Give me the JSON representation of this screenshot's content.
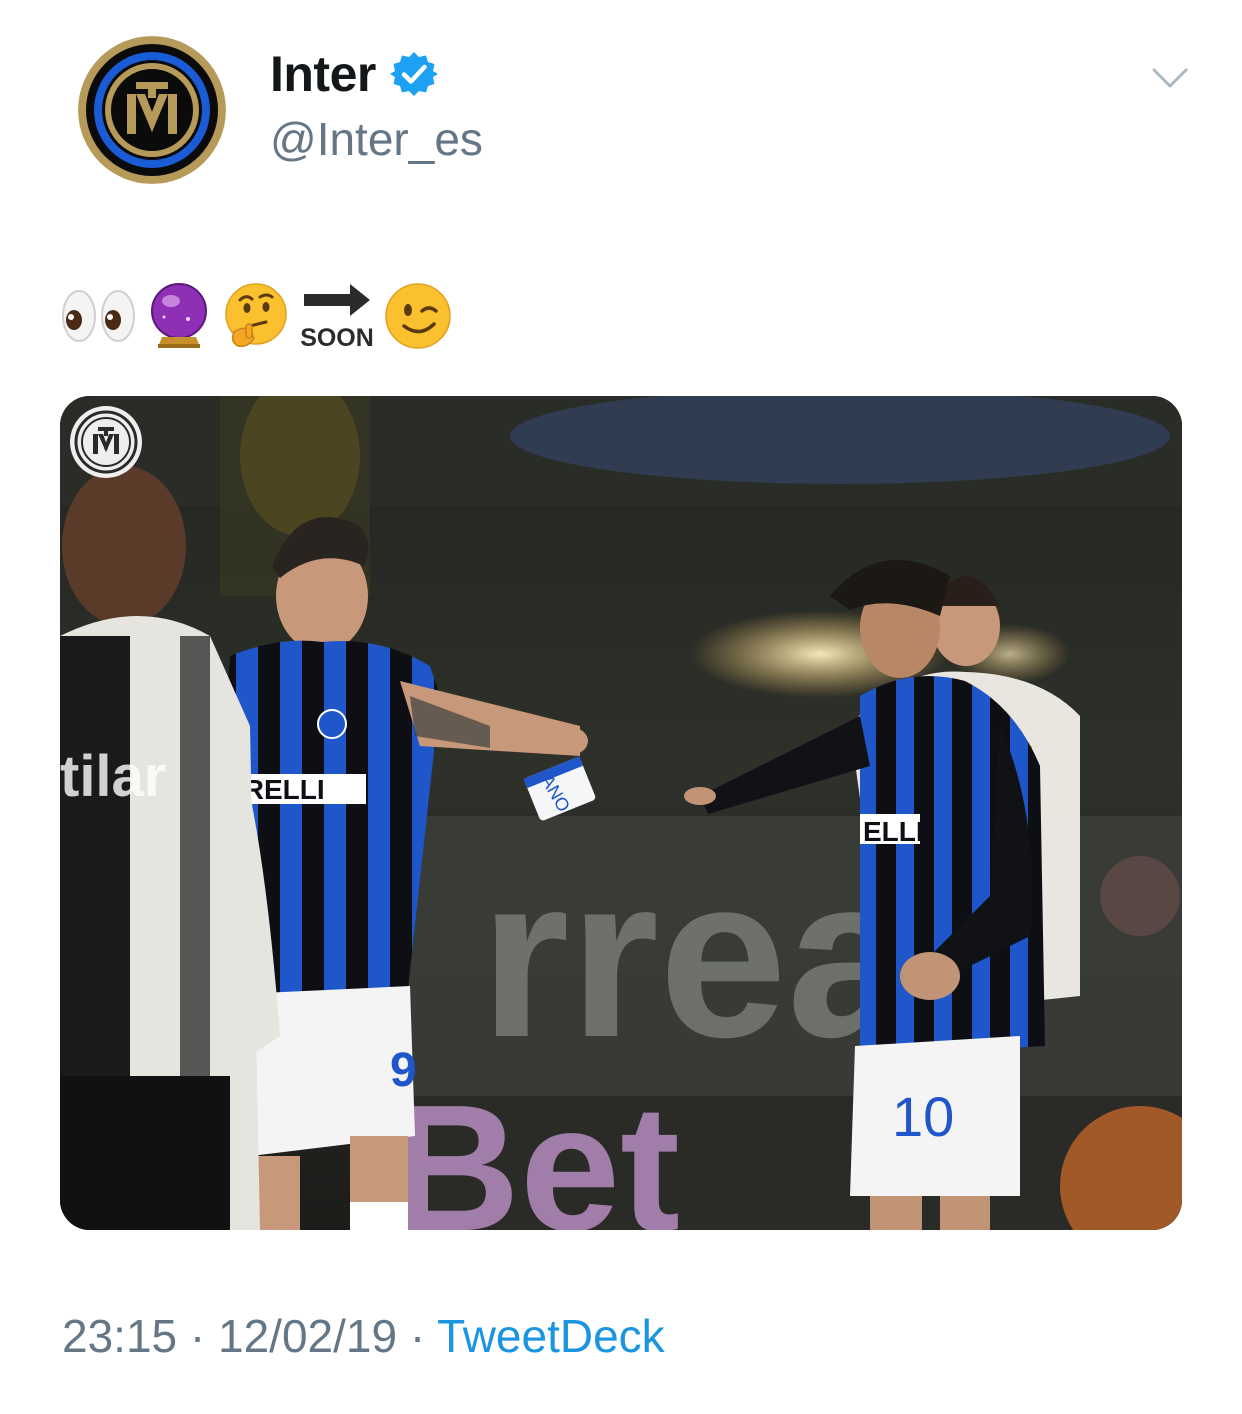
{
  "tweet": {
    "author": {
      "display_name": "Inter",
      "handle": "@Inter_es",
      "verified": true,
      "avatar_icon": "inter-crest-icon"
    },
    "menu_icon": "chevron-down-icon",
    "text_emojis": [
      "eyes",
      "crystal-ball",
      "thinking-face",
      "soon-arrow",
      "winking-face"
    ],
    "soon_label": "SOON",
    "media": {
      "watermark_icon": "inter-crest-icon",
      "shirt_sponsor_left": "IRELLI",
      "shirt_sponsor_right": "ELLI",
      "armband_text": "ANO",
      "number_left": "9",
      "number_right": "10",
      "sleeve_text_parma": "tilar",
      "board_text": "rrea",
      "board_text_bottom": "Bet"
    },
    "meta": {
      "time": "23:15",
      "separator": " · ",
      "date": "12/02/19",
      "source": "TweetDeck"
    }
  },
  "colors": {
    "text_primary": "#14171a",
    "text_secondary": "#657786",
    "link": "#1b95e0",
    "verified": "#1da1f2",
    "inter_blue": "#1a5bd6",
    "inter_black": "#0b0b0c",
    "inter_gold": "#b59a5a"
  }
}
